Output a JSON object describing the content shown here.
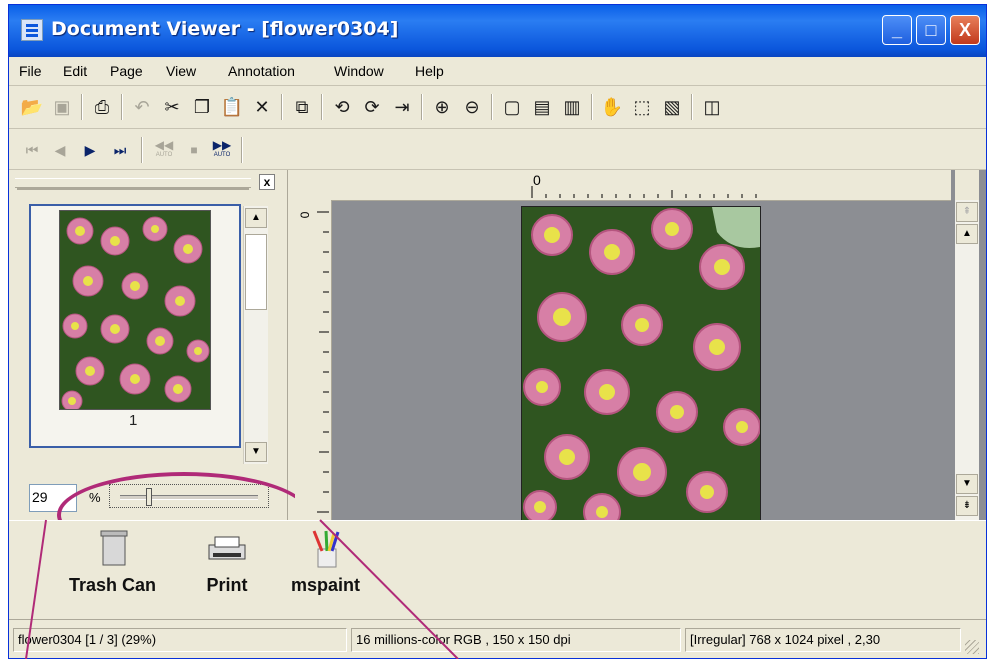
{
  "window": {
    "title": "Document Viewer - [flower0304]"
  },
  "window_buttons": {
    "minimize": "_",
    "maximize": "□",
    "close": "X"
  },
  "menu": [
    "File",
    "Edit",
    "Page",
    "View",
    "Annotation",
    "Window",
    "Help"
  ],
  "toolbar1_icons": [
    "open-folder-icon",
    "save-icon",
    "print-icon",
    "undo-icon",
    "cut-icon",
    "copy-icon",
    "paste-icon",
    "delete-icon",
    "duplicate-page-icon",
    "rotate-left-icon",
    "rotate-right-icon",
    "flip-page-icon",
    "zoom-in-icon",
    "zoom-out-icon",
    "fit-page-icon",
    "fit-width-icon",
    "fit-height-icon",
    "hand-tool-icon",
    "select-rect-icon",
    "image-icon",
    "panel-toggle-icon"
  ],
  "toolbar2_icons": [
    "first-page-icon",
    "prev-page-icon",
    "next-page-icon",
    "last-page-icon"
  ],
  "toolbar2": {
    "auto_rewind_label": "AUTO",
    "auto_forward_label": "AUTO"
  },
  "thumbnail_panel": {
    "close_glyph": "x",
    "thumbnails": [
      {
        "label": "1"
      }
    ],
    "zoom_value": "29",
    "zoom_unit": "%",
    "zoom_slider_level": 0.29
  },
  "ruler": {
    "h_zero": "0",
    "v_zero": "0"
  },
  "dock": [
    {
      "label": "Trash Can",
      "icon": "trash-can-icon"
    },
    {
      "label": "Print",
      "icon": "printer-icon"
    },
    {
      "label": "mspaint",
      "icon": "paint-brushes-icon"
    }
  ],
  "status": {
    "page_info": "flower0304 [1 / 3] (29%)",
    "color_info": "16 millions-color RGB ,  150 x 150 dpi",
    "size_info": "[Irregular]  768 x 1024 pixel , 2,30"
  },
  "colors": {
    "titlebar": "#0b56dc",
    "callout": "#b02a78",
    "viewer_bg": "#8c8e93",
    "chrome": "#ece9d8"
  }
}
